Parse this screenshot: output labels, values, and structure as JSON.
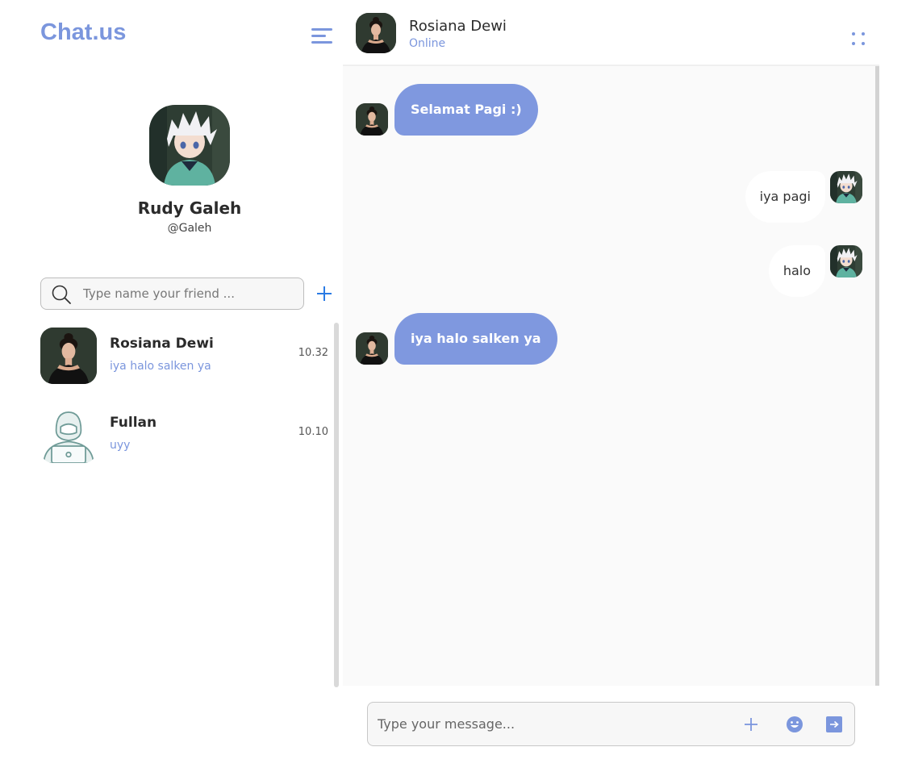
{
  "app": {
    "title": "Chat.us"
  },
  "profile": {
    "name": "Rudy Galeh",
    "handle": "@Galeh"
  },
  "search": {
    "placeholder": "Type name your friend ..."
  },
  "contacts": [
    {
      "name": "Rosiana Dewi",
      "last_message": "iya halo salken ya",
      "time": "10.32"
    },
    {
      "name": "Fullan",
      "last_message": "uyy",
      "time": "10.10"
    }
  ],
  "chat": {
    "contact_name": "Rosiana Dewi",
    "status": "Online",
    "messages": [
      {
        "direction": "incoming",
        "text": "Selamat Pagi :)"
      },
      {
        "direction": "outgoing",
        "text": "iya pagi"
      },
      {
        "direction": "outgoing",
        "text": "halo"
      },
      {
        "direction": "incoming",
        "text": "iya halo salken ya"
      }
    ]
  },
  "composer": {
    "placeholder": "Type your message..."
  },
  "colors": {
    "accent": "#7b96dd",
    "bubble_in": "#7f98df",
    "chat_bg": "#fafafa"
  },
  "icons": [
    "menu-icon",
    "search-icon",
    "plus-icon",
    "more-dots-icon",
    "emoji-icon",
    "send-icon"
  ]
}
